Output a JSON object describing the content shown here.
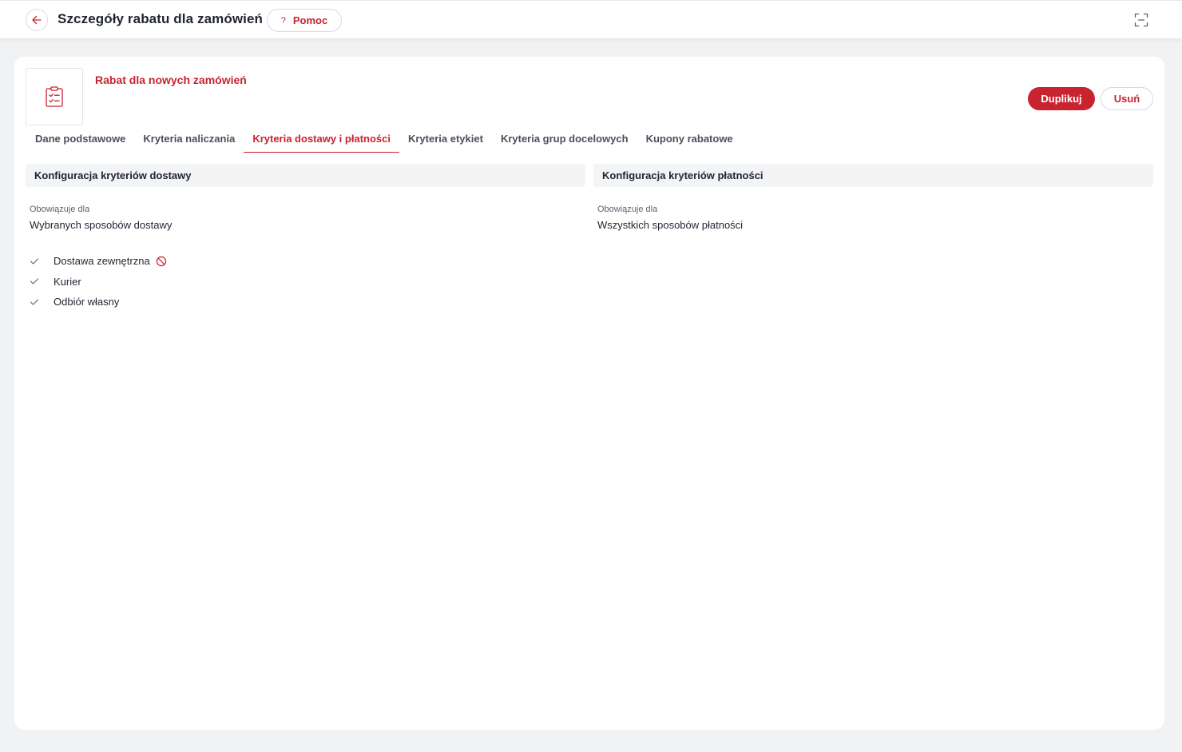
{
  "header": {
    "back_icon": "arrow-left-icon",
    "title": "Szczegóły rabatu dla zamówień",
    "help_label": "Pomoc",
    "help_icon_glyph": "?",
    "fullscreen_icon": "fullscreen-icon"
  },
  "discount": {
    "name": "Rabat dla nowych zamówień",
    "thumbnail_icon": "clipboard-check-icon",
    "duplicate_label": "Duplikuj",
    "delete_label": "Usuń"
  },
  "tabs": [
    {
      "label": "Dane podstawowe",
      "active": false
    },
    {
      "label": "Kryteria naliczania",
      "active": false
    },
    {
      "label": "Kryteria dostawy i płatności",
      "active": true
    },
    {
      "label": "Kryteria etykiet",
      "active": false
    },
    {
      "label": "Kryteria grup docelowych",
      "active": false
    },
    {
      "label": "Kupony rabatowe",
      "active": false
    }
  ],
  "delivery": {
    "heading": "Konfiguracja kryteriów dostawy",
    "applies_label": "Obowiązuje dla",
    "applies_value": "Wybranych sposobów dostawy",
    "methods": [
      {
        "name": "Dostawa zewnętrzna",
        "disabled": true
      },
      {
        "name": "Kurier",
        "disabled": false
      },
      {
        "name": "Odbiór własny",
        "disabled": false
      }
    ]
  },
  "payment": {
    "heading": "Konfiguracja kryteriów płatności",
    "applies_label": "Obowiązuje dla",
    "applies_value": "Wszystkich sposobów płatności"
  },
  "colors": {
    "accent": "#c8232f",
    "background": "#f1f2f4",
    "panel_header": "#f3f4f6"
  }
}
